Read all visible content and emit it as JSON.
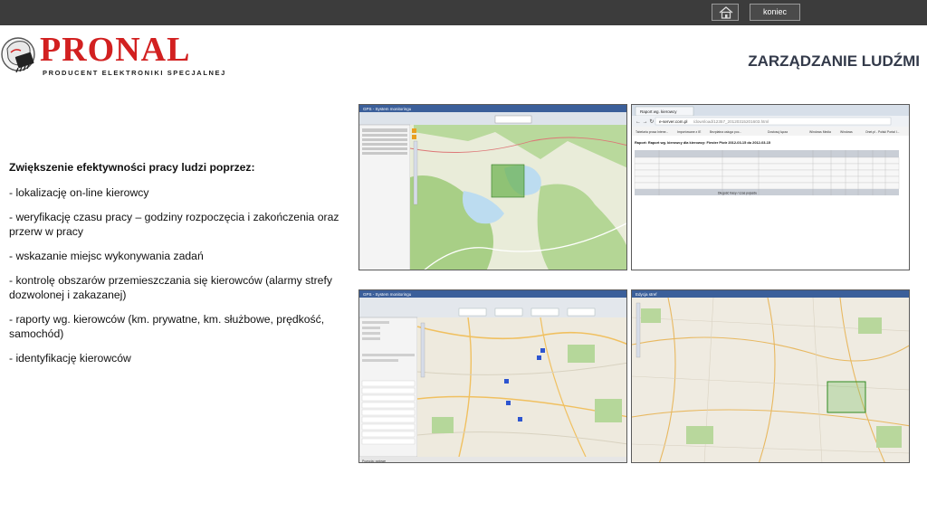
{
  "topbar": {
    "home_icon": "home-icon",
    "koniec_label": "koniec"
  },
  "logo": {
    "name": "PRONAL",
    "tagline": "PRODUCENT ELEKTRONIKI SPECJALNEJ"
  },
  "page_title": "ZARZĄDZANIE LUDŹMI",
  "content": {
    "heading": "Zwiększenie efektywności pracy ludzi poprzez:",
    "items": [
      "- lokalizację on-line kierowcy",
      "- weryfikację czasu pracy – godziny rozpoczęcia i zakończenia oraz przerw w pracy",
      "- wskazanie miejsc wykonywania zadań",
      "- kontrolę obszarów przemieszczania się kierowców (alarmy strefy dozwolonej i zakazanej)",
      "- raporty wg. kierowców (km. prywatne, km. służbowe, prędkość, samochód)",
      "- identyfikację kierowców"
    ]
  },
  "screenshots": {
    "s1": {
      "title": "GPS - System monitoringu"
    },
    "s2": {
      "tab": "Raport wg. kierowcy",
      "url_host": "e-server.com.pl",
      "url_path": "/download/12357_20120315201603.html",
      "bookmarks": [
        "Tabelaria prosa Intene...",
        "Importowane z IE",
        "Bezpłatna usługa poc...",
        "Dostosuj łącza",
        "Windows Media",
        "Windows",
        "Onet.pl - Polski Portal I..."
      ],
      "report_title": "Raport: Raport wg. kierowcy dla kierowcy: Fiester Piotr 2012-03-15 do 2012-03-15",
      "summary_label": "Długość trasy / czas pojazdu"
    },
    "s3": {
      "title": "GPS - System monitoringu",
      "status": "Pozycja: gotowe"
    },
    "s4": {
      "title": "Edycja stref"
    }
  }
}
